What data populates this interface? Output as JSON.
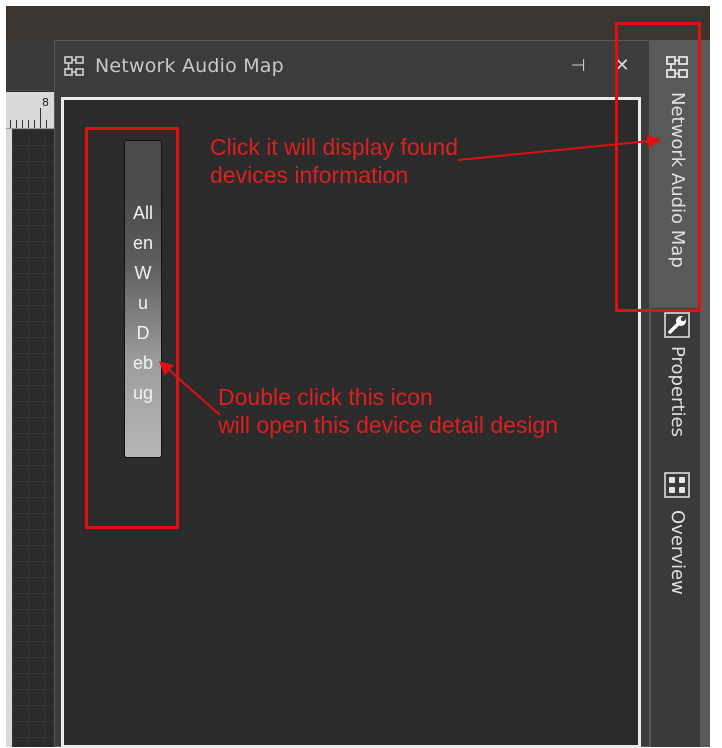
{
  "panel": {
    "title": "Network Audio Map",
    "pin_glyph": "⊣",
    "close_glyph": "✕",
    "icon": "network-map-icon"
  },
  "canvas": {
    "ruler_number": "8"
  },
  "device": {
    "name_lines": [
      "All",
      "en",
      "W",
      "u",
      "D",
      "eb",
      "ug"
    ]
  },
  "side_tabs": [
    {
      "label": "Network Audio Map",
      "icon": "network-map-icon",
      "active": true
    },
    {
      "label": "Properties",
      "icon": "wrench-icon",
      "active": false
    },
    {
      "label": "Overview",
      "icon": "overview-grid-icon",
      "active": false
    }
  ],
  "annotations": {
    "top_note": [
      "Click it will display found",
      "devices information"
    ],
    "bottom_note": [
      "Double click this icon",
      "will open this device detail design"
    ],
    "color": "#e01010"
  },
  "colors": {
    "panel_bg": "#3c3c3c",
    "body_bg": "#2b2b2b",
    "annotation_red": "#e01010"
  }
}
